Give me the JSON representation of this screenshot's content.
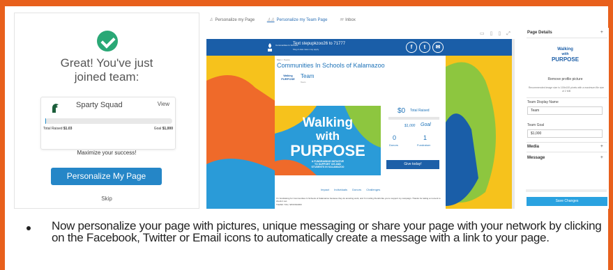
{
  "left_panel": {
    "greeting_line1": "Great! You've just",
    "greeting_line2": "joined team:",
    "team_name": "Sparty Squad",
    "view_label": "View",
    "total_raised_label": "Total Raised",
    "total_raised_value": "$1.03",
    "goal_label": "Goal",
    "goal_value": "$1,000",
    "progress_fraction": 0.001,
    "maximize_text": "Maximize your success!",
    "personalize_button": "Personalize My Page",
    "skip_label": "Skip"
  },
  "top_nav": {
    "items": [
      {
        "icon": "person-icon",
        "label": "Personalize my Page"
      },
      {
        "icon": "team-icon",
        "label": "Personalize my Team Page"
      },
      {
        "icon": "inbox-icon",
        "label": "Inbox"
      }
    ],
    "active_index": 1
  },
  "preview": {
    "header_text": "Text stepupkzoo26 to 71777",
    "header_subtext": "Msg & data rates may apply",
    "org_logo_text": "Communities In Schools",
    "social": [
      "facebook-icon",
      "twitter-icon",
      "email-icon"
    ],
    "breadcrumb": "Main > Teams",
    "org_title": "Communities In Schools of Kalamazoo",
    "team_label": "Team",
    "team_sub": "Team",
    "banner_line1": "Walking",
    "banner_line2": "with",
    "banner_line3": "PURPOSE",
    "banner_tagline1": "A FUNDRAISING INITIATIVE",
    "banner_tagline2": "TO SUPPORT CIS AND",
    "banner_tagline3": "STUDENTS IN KALAMAZOO",
    "amount": "$0",
    "amount_label": "Total Raised",
    "goal_amount": "$1,000",
    "goal_script": "Goal",
    "donors_count": "0",
    "donors_label": "Donors",
    "fundraiser_count": "1",
    "fundraiser_label": "Fundraiser",
    "give_button": "Give today!",
    "tabs": [
      "Impact",
      "Individuals",
      "Donors",
      "Challenges"
    ],
    "description": "I'm fundraising for Communities In Schools of Kalamazoo because they do amazing work, and I'm inviting friends like you to support my campaign. Thanks for taking a moment to check it out.",
    "thanks": "THANK YOU, SPONSORS!"
  },
  "tools": [
    "monitor-icon",
    "tablet-icon",
    "phone-icon",
    "expand-icon"
  ],
  "right_panel": {
    "page_details_label": "Page Details",
    "logo_line1": "Walking",
    "logo_line2": "with",
    "logo_line3": "PURPOSE",
    "remove_picture": "Remove profile picture",
    "recommend_text": "Recommended image size is 100x100 pixels with a maximum file size of 2 MB",
    "team_display_name_label": "Team Display Name",
    "team_display_name_value": "Team",
    "team_goal_label": "Team Goal",
    "team_goal_value": "$1,000",
    "media_label": "Media",
    "message_label": "Message",
    "save_button": "Save Changes"
  },
  "bullet_text": "Now personalize your page with pictures, unique messaging or share your page with your network by clicking on the Facebook, Twitter or Email icons to automatically create a message with a link to your page.",
  "colors": {
    "frame": "#e8601c",
    "check": "#2aa876",
    "primary_blue": "#2586c7",
    "header_blue": "#1a5ea8",
    "save_blue": "#2aa2e0"
  }
}
